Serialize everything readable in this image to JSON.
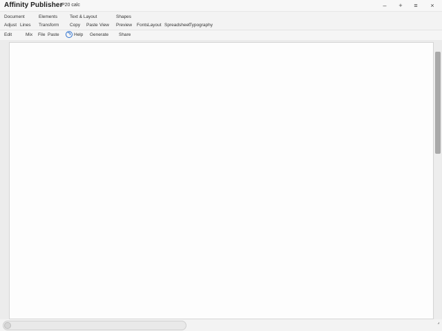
{
  "window": {
    "app_title": "Affinity Publisher",
    "doc_title": "P20 calc",
    "controls": {
      "minimize": "–",
      "add": "+",
      "menu": "≡",
      "close": "×"
    }
  },
  "menu_row1": [
    "Document",
    "Elements",
    "Text & Layout",
    "Shapes"
  ],
  "menu_row2": [
    "Adjust",
    "Lines",
    "Transform",
    "Copy",
    "Paste",
    "View",
    "Preview",
    "Fonts",
    "Layout",
    "Spreadsheet",
    "Typography"
  ],
  "toolbar": {
    "items": [
      "Edit",
      "Mix",
      "File",
      "Paste"
    ],
    "help_label": "Help",
    "more_items": [
      "Generate",
      "Share"
    ]
  },
  "statusbar": {
    "grip": "⌟"
  }
}
